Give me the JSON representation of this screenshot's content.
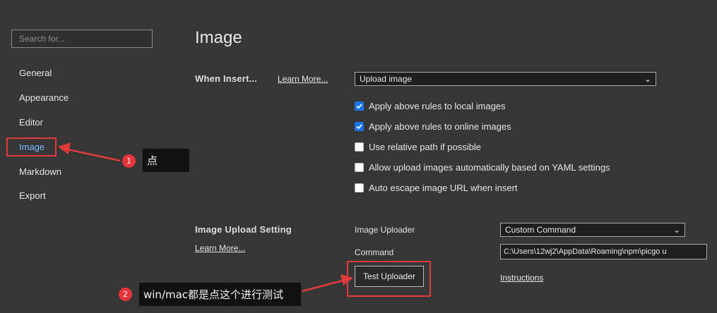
{
  "sidebar": {
    "search_placeholder": "Search for...",
    "items": [
      {
        "label": "General"
      },
      {
        "label": "Appearance"
      },
      {
        "label": "Editor"
      },
      {
        "label": "Image"
      },
      {
        "label": "Markdown"
      },
      {
        "label": "Export"
      }
    ],
    "active_item": "Image"
  },
  "main": {
    "title": "Image",
    "when_insert": {
      "label": "When Insert...",
      "learn_more": "Learn More...",
      "action_value": "Upload image"
    },
    "options": [
      {
        "label": "Apply above rules to local images",
        "checked": true
      },
      {
        "label": "Apply above rules to online images",
        "checked": true
      },
      {
        "label": "Use relative path if possible",
        "checked": false
      },
      {
        "label": "Allow upload images automatically based on YAML settings",
        "checked": false
      },
      {
        "label": "Auto escape image URL when insert",
        "checked": false
      }
    ],
    "upload_setting": {
      "label": "Image Upload Setting",
      "learn_more": "Learn More...",
      "uploader_label": "Image Uploader",
      "uploader_value": "Custom Command",
      "command_label": "Command",
      "command_value": "C:\\Users\\12wj2\\AppData\\Roaming\\npm\\picgo u",
      "test_button": "Test Uploader",
      "instructions": "Instructions"
    }
  },
  "annotations": {
    "badge1": "1",
    "callout1": "点",
    "badge2": "2",
    "callout2": "win/mac都是点这个进行测试"
  },
  "colors": {
    "background": "#363636",
    "accent_active": "#7cb7ff",
    "checkbox_checked": "#1a73e8",
    "annotation_red": "#e03a3a"
  }
}
